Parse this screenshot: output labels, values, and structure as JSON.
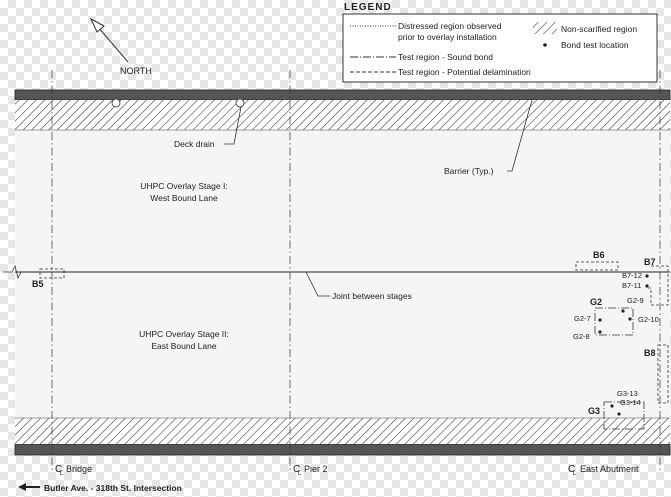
{
  "legend": {
    "title": "LEGEND",
    "distressed_line1": "Distressed region observed",
    "distressed_line2": "prior to overlay installation",
    "sound_bond": "Test region - Sound bond",
    "potential_delamination": "Test region - Potential delamination",
    "non_scarified": "Non-scarified region",
    "bond_test_location": "Bond test location"
  },
  "north_label": "NORTH",
  "labels": {
    "deck_drain": "Deck drain",
    "barrier": "Barrier (Typ.)",
    "stage1_line1": "UHPC Overlay Stage I:",
    "stage1_line2": "West Bound Lane",
    "stage2_line1": "UHPC Overlay Stage II:",
    "stage2_line2": "East Bound Lane",
    "joint": "Joint between stages"
  },
  "test_regions": {
    "b5": "B5",
    "b6": "B6",
    "b7": "B7",
    "b7_12": "B7-12",
    "b7_11": "B7-11",
    "g2": "G2",
    "g2_9": "G2-9",
    "g2_7": "G2-7",
    "g2_10": "G2-10",
    "g2_8": "G2-8",
    "b8": "B8",
    "g3": "G3",
    "g3_13": "G3-13",
    "g3_14": "G3-14"
  },
  "centerlines": {
    "bridge": "Bridge",
    "pier2": "Pier 2",
    "east_abutment": "East Abutment",
    "cl_symbol": "C",
    "cl_sub": "L"
  },
  "footer_direction": "Butler Ave. - 318th St. Intersection"
}
